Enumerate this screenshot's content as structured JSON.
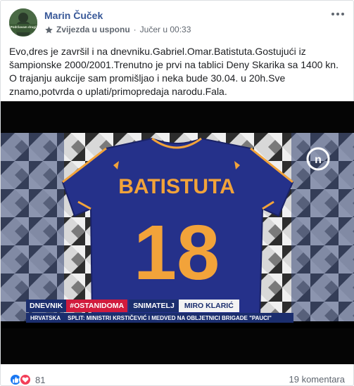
{
  "post": {
    "author": "Marin Čuček",
    "avatar_text": "Podržavam drugi",
    "group": "Zvijezda u usponu",
    "separator": "·",
    "time": "Jučer u 00:33",
    "body": "Evo,dres je završil i na dnevniku.Gabriel.Omar.Batistuta.Gostujući iz šampionske 2000/2001.Trenutno je prvi na tablici Deny Skarika sa 1400 kn. O trajanju aukcije sam promišljao i neka bude 30.04. u 20h.Sve znamo,potvrda o uplati/primopredaja narodu.Fala."
  },
  "media": {
    "jersey_name": "BATISTUTA",
    "jersey_number": "18",
    "channel_logo": "n",
    "lower_third": {
      "show": "DNEVNIK",
      "hashtag": "#OSTANIDOMA",
      "role": "SNIMATELJ",
      "person": "MIRO KLARIĆ"
    },
    "ticker": {
      "region": "HRVATSKA",
      "headline": "SPLIT: MINISTRI KRSTIČEVIĆ I MEDVED NA OBLJETNICI BRIGADE \"PAUCI\""
    }
  },
  "footer": {
    "reaction_count": "81",
    "comments": "19 komentara"
  },
  "icons": {
    "more": "more-options-icon",
    "group": "group-star-icon",
    "like": "like-icon",
    "love": "love-icon"
  },
  "colors": {
    "link": "#385898",
    "like": "#1877f2",
    "love": "#f33e58",
    "jersey": "#25318a",
    "number": "#f2a33a",
    "news_blue": "#1b2e6e",
    "news_red": "#d11b3d"
  }
}
